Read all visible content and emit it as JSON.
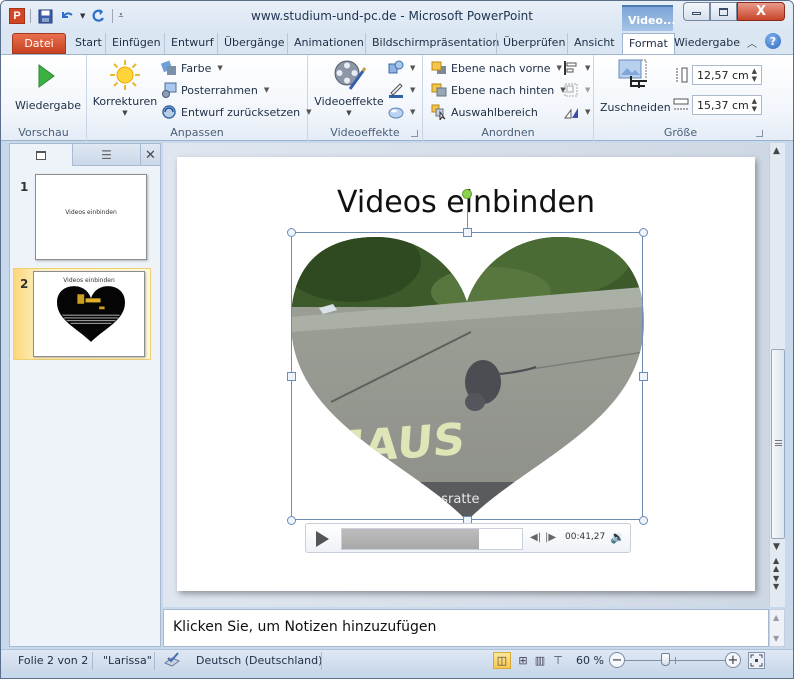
{
  "window": {
    "title": "www.studium-und-pc.de - Microsoft PowerPoint",
    "context_tab_group": "Video...",
    "controls": {
      "minimize": "—",
      "maximize": "▢",
      "close": "X"
    }
  },
  "quick_access": {
    "app_icon_letter": "P",
    "items": [
      "save-icon",
      "undo-icon",
      "redo-icon",
      "customize-qat-icon"
    ]
  },
  "ribbon_tabs": [
    {
      "label": "Datei",
      "type": "file"
    },
    {
      "label": "Start"
    },
    {
      "label": "Einfügen"
    },
    {
      "label": "Entwurf"
    },
    {
      "label": "Übergänge"
    },
    {
      "label": "Animationen"
    },
    {
      "label": "Bildschirmpräsentation"
    },
    {
      "label": "Überprüfen"
    },
    {
      "label": "Ansicht"
    },
    {
      "label": "Format",
      "active": true
    },
    {
      "label": "Wiedergabe"
    }
  ],
  "ribbon": {
    "vorschau": {
      "label": "Vorschau",
      "wiedergabe": "Wiedergabe"
    },
    "anpassen": {
      "label": "Anpassen",
      "korrekturen": "Korrekturen",
      "farbe": "Farbe",
      "posterrahmen": "Posterrahmen",
      "entwurf_zuruecksetzen": "Entwurf zurücksetzen"
    },
    "videoeffekte": {
      "label": "Videoeffekte",
      "videoeffekte_button": "Videoeffekte"
    },
    "anordnen": {
      "label": "Anordnen",
      "ebene_vorne": "Ebene nach vorne",
      "ebene_hinten": "Ebene nach hinten",
      "auswahlbereich": "Auswahlbereich"
    },
    "groesse": {
      "label": "Größe",
      "zuschneiden": "Zuschneiden",
      "height_value": "12,57  cm",
      "width_value": "15,37  cm"
    }
  },
  "slides_pane": {
    "slides": [
      {
        "number": "1",
        "title": "Videos einbinden",
        "selected": false
      },
      {
        "number": "2",
        "title": "Videos einbinden",
        "selected": true
      }
    ]
  },
  "slide": {
    "title": "Videos einbinden",
    "video_overlay_text": "MAUS",
    "video_caption_text": "hsratte",
    "media": {
      "time": "00:41,27",
      "progress": 0.76
    }
  },
  "notes": {
    "placeholder": "Klicken Sie, um Notizen hinzuzufügen"
  },
  "statusbar": {
    "slide_counter": "Folie 2 von 2",
    "theme": "\"Larissa\"",
    "language": "Deutsch (Deutschland)",
    "zoom_level": "60 %",
    "zoom_fraction": 0.4
  },
  "colors": {
    "file_tab": "#d24726",
    "selection_accent": "#6d8db3",
    "rotation_handle": "#8ad24c",
    "selected_thumb": "#fbd77a"
  }
}
